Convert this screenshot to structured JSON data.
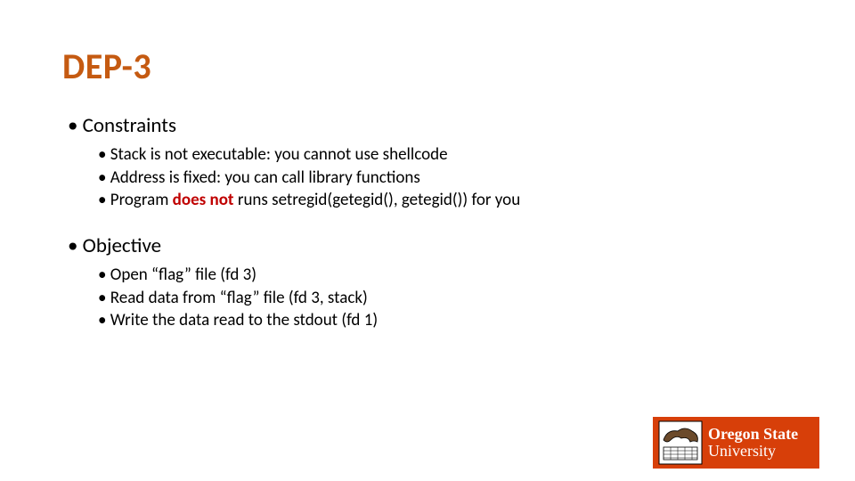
{
  "title": "DEP-3",
  "sections": [
    {
      "heading": "Constraints",
      "items": [
        {
          "pre": "Stack is not executable: you cannot use shellcode",
          "em": "",
          "post": ""
        },
        {
          "pre": "Address is fixed: you can call library functions",
          "em": "",
          "post": ""
        },
        {
          "pre": "Program ",
          "em": "does not",
          "post": " runs setregid(getegid(), getegid()) for you"
        }
      ]
    },
    {
      "heading": "Objective",
      "items": [
        {
          "pre": "Open “flag” file (fd 3)",
          "em": "",
          "post": ""
        },
        {
          "pre": "Read data from “flag” file (fd 3, stack)",
          "em": "",
          "post": ""
        },
        {
          "pre": "Write the data read to the stdout (fd 1)",
          "em": "",
          "post": ""
        }
      ]
    }
  ],
  "logo": {
    "line1": "Oregon State",
    "line2": "University"
  }
}
